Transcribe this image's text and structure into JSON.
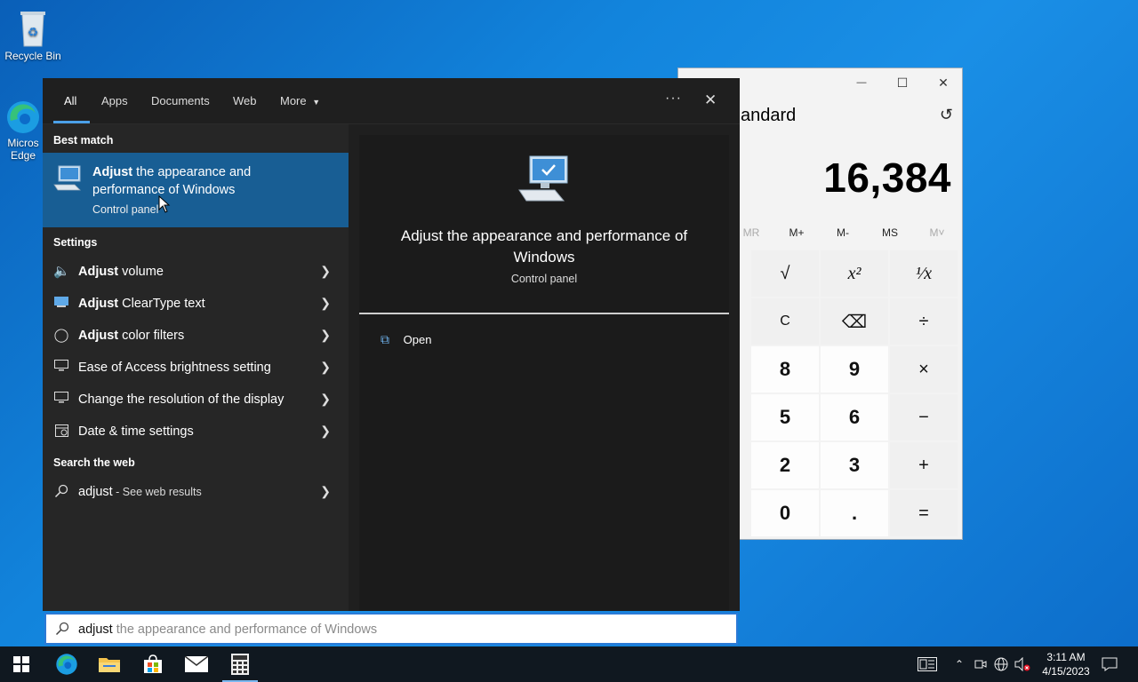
{
  "desktop": {
    "icons": [
      {
        "label": "Recycle Bin",
        "icon": "recycle-bin-icon"
      },
      {
        "label": "Micros\nEdge",
        "icon": "edge-icon"
      }
    ]
  },
  "calculator": {
    "mode": "andard",
    "display": "16,384",
    "window_controls": {
      "minimize": "—",
      "maximize": "☐",
      "close": "✕"
    },
    "memory": [
      "MR",
      "M+",
      "M-",
      "MS",
      "M˅"
    ],
    "keys": [
      [
        "√",
        "x²",
        "¹⁄x"
      ],
      [
        "C",
        "⌫",
        "÷"
      ],
      [
        "8",
        "9",
        "×"
      ],
      [
        "5",
        "6",
        "−"
      ],
      [
        "2",
        "3",
        "+"
      ],
      [
        "0",
        ".",
        "="
      ]
    ]
  },
  "search": {
    "tabs": [
      "All",
      "Apps",
      "Documents",
      "Web",
      "More"
    ],
    "active_tab": "All",
    "more_options": "···",
    "close": "✕",
    "best_match_header": "Best match",
    "best_match": {
      "bold": "Adjust",
      "rest": " the appearance and performance of Windows",
      "sub": "Control panel"
    },
    "settings_header": "Settings",
    "settings": [
      {
        "bold": "Adjust",
        "rest": " volume",
        "icon": "speaker-icon"
      },
      {
        "bold": "Adjust",
        "rest": " ClearType text",
        "icon": "cleartype-icon"
      },
      {
        "bold": "Adjust",
        "rest": " color filters",
        "icon": "palette-icon"
      },
      {
        "bold": "",
        "rest": "Ease of Access brightness setting",
        "icon": "monitor-icon"
      },
      {
        "bold": "",
        "rest": "Change the resolution of the display",
        "icon": "monitor-icon"
      },
      {
        "bold": "",
        "rest": "Date & time settings",
        "icon": "calendar-icon"
      }
    ],
    "web_header": "Search the web",
    "web_result": {
      "query": "adjust",
      "suffix": " - See web results"
    },
    "detail": {
      "title": "Adjust the appearance and performance of Windows",
      "sub": "Control panel",
      "open": "Open"
    },
    "box": {
      "typed": "adjust",
      "ghost": " the appearance and performance of Windows"
    }
  },
  "taskbar": {
    "clock_time": "3:11 AM",
    "clock_date": "4/15/2023",
    "apps": [
      "start-icon",
      "edge-icon",
      "file-explorer-icon",
      "store-icon",
      "mail-icon",
      "calculator-icon"
    ]
  }
}
